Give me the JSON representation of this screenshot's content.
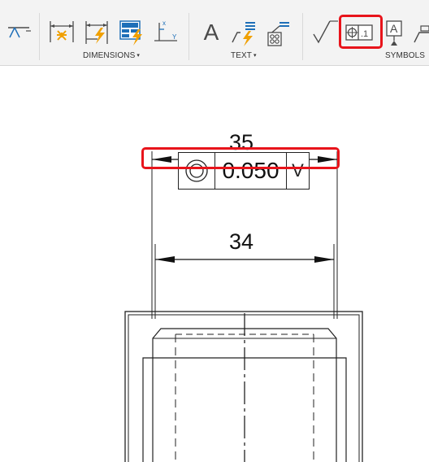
{
  "ribbon": {
    "groups": {
      "dimensions": "DIMENSIONS",
      "text": "TEXT",
      "symbols": "SYMBOLS"
    },
    "caret": "▾",
    "text_tool_glyph": "A",
    "datum_tool_glyph": "A",
    "fcf_tool_value": ".1",
    "highlighted_tool": "feature-control-frame-tool"
  },
  "drawing": {
    "dim_top": "35",
    "dim_lower": "34",
    "fcf_tolerance": "0.050",
    "fcf_symbol": "concentricity-icon",
    "fcf_modifier": "V"
  },
  "colors": {
    "highlight": "#e8141b",
    "icon_blue": "#1e6fb8",
    "icon_orange": "#f0a000"
  }
}
